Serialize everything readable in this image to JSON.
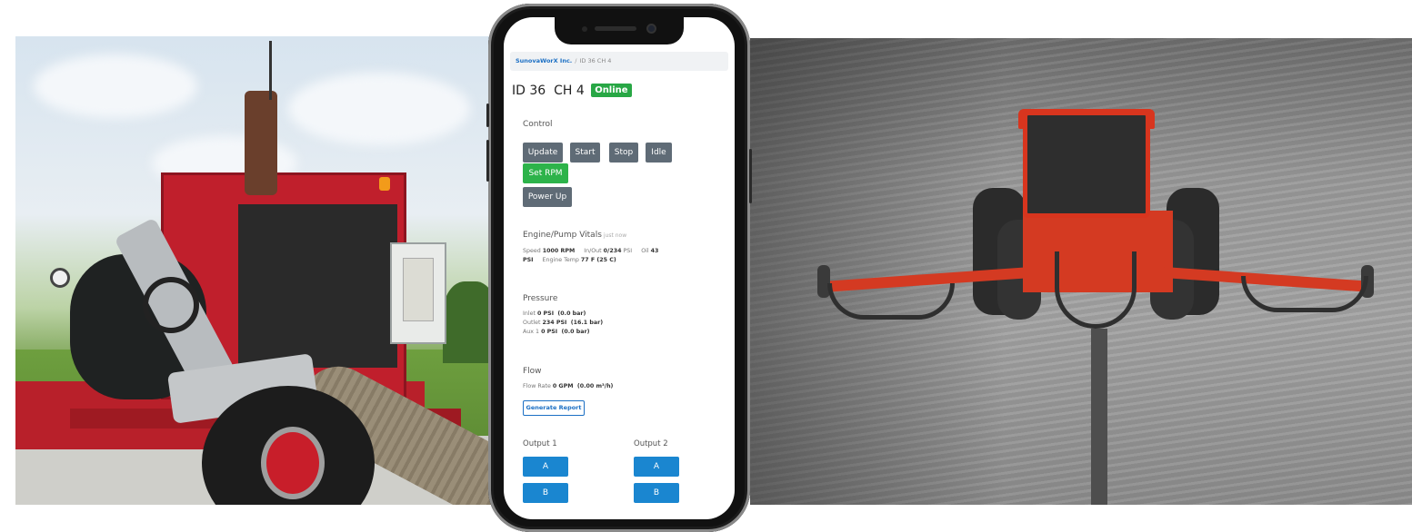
{
  "breadcrumb": {
    "company": "SunovaWorX Inc.",
    "separator": "/",
    "current": "ID 36 CH 4"
  },
  "page": {
    "title": "ID 36  CH 4",
    "status_badge": "Online",
    "status_color": "#28a745"
  },
  "control": {
    "heading": "Control",
    "buttons": {
      "update": "Update",
      "start": "Start",
      "stop": "Stop",
      "idle": "Idle",
      "set_rpm": "Set RPM",
      "power_up": "Power Up"
    }
  },
  "vitals": {
    "heading": "Engine/Pump Vitals",
    "updated": "just now",
    "speed_label": "Speed",
    "speed_value": "1000 RPM",
    "inout_label": "In/Out",
    "inout_value": "0/234",
    "inout_unit": "PSI",
    "oil_label": "Oil",
    "oil_value": "43",
    "oil_unit": "PSI",
    "temp_label": "Engine Temp",
    "temp_value": "77 F (25 C)"
  },
  "pressure": {
    "heading": "Pressure",
    "inlet_label": "Inlet",
    "inlet_value": "0 PSI  (0.0 bar)",
    "outlet_label": "Outlet",
    "outlet_value": "234 PSI  (16.1 bar)",
    "aux_label": "Aux 1",
    "aux_value": "0 PSI  (0.0 bar)"
  },
  "flow": {
    "heading": "Flow",
    "rate_label": "Flow Rate",
    "rate_value": "0 GPM  (0.00 m³/h)",
    "report_button": "Generate Report"
  },
  "outputs": [
    {
      "heading": "Output 1",
      "button_a": "A",
      "button_b": "B"
    },
    {
      "heading": "Output 2",
      "button_a": "A",
      "button_b": "B"
    }
  ],
  "colors": {
    "accent_blue": "#1a86d0",
    "link_blue": "#1b6fc4",
    "button_gray": "#5f6b76",
    "button_green": "#2db34a",
    "equipment_red": "#c01f2c"
  }
}
